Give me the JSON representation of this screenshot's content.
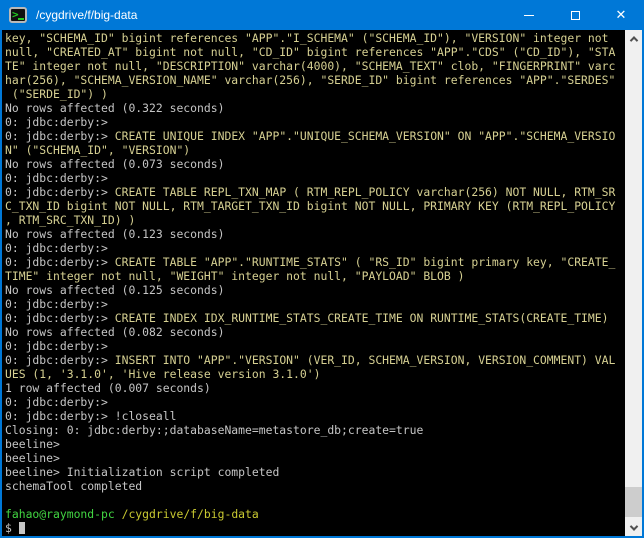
{
  "window": {
    "title": "/cygdrive/f/big-data",
    "app_icon": "mintty-terminal-icon",
    "controls": {
      "minimize": "minimize-icon",
      "maximize": "maximize-icon",
      "close": "close-icon"
    }
  },
  "colors": {
    "titlebar": "#0078d7",
    "terminal_bg": "#000000",
    "text_default": "#c5c5c5",
    "text_command": "#d6d092",
    "text_user_host": "#42d542",
    "text_path": "#c9c931",
    "scrollbar_track": "#f0f0f0",
    "scrollbar_thumb": "#cdcdcd"
  },
  "scrollbar": {
    "up_icon": "chevron-up-icon",
    "down_icon": "chevron-down-icon"
  },
  "terminal": {
    "lines": [
      [
        {
          "c": "cmd",
          "t": "key, \"SCHEMA_ID\" bigint references \"APP\".\"I_SCHEMA\" (\"SCHEMA_ID\"), \"VERSION\" integer not"
        }
      ],
      [
        {
          "c": "cmd",
          "t": "null, \"CREATED_AT\" bigint not null, \"CD_ID\" bigint references \"APP\".\"CDS\" (\"CD_ID\"), \"STA"
        }
      ],
      [
        {
          "c": "cmd",
          "t": "TE\" integer not null, \"DESCRIPTION\" varchar(4000), \"SCHEMA_TEXT\" clob, \"FINGERPRINT\" varc"
        }
      ],
      [
        {
          "c": "cmd",
          "t": "har(256), \"SCHEMA_VERSION_NAME\" varchar(256), \"SERDE_ID\" bigint references \"APP\".\"SERDES\""
        }
      ],
      [
        {
          "c": "cmd",
          "t": " (\"SERDE_ID\") )"
        }
      ],
      [
        {
          "c": "fg",
          "t": "No rows affected (0.322 seconds)"
        }
      ],
      [
        {
          "c": "fg",
          "t": "0: jdbc:derby:>"
        }
      ],
      [
        {
          "c": "fg",
          "t": "0: jdbc:derby:> "
        },
        {
          "c": "cmd",
          "t": "CREATE UNIQUE INDEX \"APP\".\"UNIQUE_SCHEMA_VERSION\" ON \"APP\".\"SCHEMA_VERSIO"
        }
      ],
      [
        {
          "c": "cmd",
          "t": "N\" (\"SCHEMA_ID\", \"VERSION\")"
        }
      ],
      [
        {
          "c": "fg",
          "t": "No rows affected (0.073 seconds)"
        }
      ],
      [
        {
          "c": "fg",
          "t": "0: jdbc:derby:>"
        }
      ],
      [
        {
          "c": "fg",
          "t": "0: jdbc:derby:> "
        },
        {
          "c": "cmd",
          "t": "CREATE TABLE REPL_TXN_MAP ( RTM_REPL_POLICY varchar(256) NOT NULL, RTM_SR"
        }
      ],
      [
        {
          "c": "cmd",
          "t": "C_TXN_ID bigint NOT NULL, RTM_TARGET_TXN_ID bigint NOT NULL, PRIMARY KEY (RTM_REPL_POLICY"
        }
      ],
      [
        {
          "c": "cmd",
          "t": ", RTM_SRC_TXN_ID) )"
        }
      ],
      [
        {
          "c": "fg",
          "t": "No rows affected (0.123 seconds)"
        }
      ],
      [
        {
          "c": "fg",
          "t": "0: jdbc:derby:>"
        }
      ],
      [
        {
          "c": "fg",
          "t": "0: jdbc:derby:> "
        },
        {
          "c": "cmd",
          "t": "CREATE TABLE \"APP\".\"RUNTIME_STATS\" ( \"RS_ID\" bigint primary key, \"CREATE_"
        }
      ],
      [
        {
          "c": "cmd",
          "t": "TIME\" integer not null, \"WEIGHT\" integer not null, \"PAYLOAD\" BLOB )"
        }
      ],
      [
        {
          "c": "fg",
          "t": "No rows affected (0.125 seconds)"
        }
      ],
      [
        {
          "c": "fg",
          "t": "0: jdbc:derby:>"
        }
      ],
      [
        {
          "c": "fg",
          "t": "0: jdbc:derby:> "
        },
        {
          "c": "cmd",
          "t": "CREATE INDEX IDX_RUNTIME_STATS_CREATE_TIME ON RUNTIME_STATS(CREATE_TIME)"
        }
      ],
      [
        {
          "c": "fg",
          "t": "No rows affected (0.082 seconds)"
        }
      ],
      [
        {
          "c": "fg",
          "t": "0: jdbc:derby:>"
        }
      ],
      [
        {
          "c": "fg",
          "t": "0: jdbc:derby:> "
        },
        {
          "c": "cmd",
          "t": "INSERT INTO \"APP\".\"VERSION\" (VER_ID, SCHEMA_VERSION, VERSION_COMMENT) VAL"
        }
      ],
      [
        {
          "c": "cmd",
          "t": "UES (1, '3.1.0', 'Hive release version 3.1.0')"
        }
      ],
      [
        {
          "c": "fg",
          "t": "1 row affected (0.007 seconds)"
        }
      ],
      [
        {
          "c": "fg",
          "t": "0: jdbc:derby:>"
        }
      ],
      [
        {
          "c": "fg",
          "t": "0: jdbc:derby:> !closeall"
        }
      ],
      [
        {
          "c": "fg",
          "t": "Closing: 0: jdbc:derby:;databaseName=metastore_db;create=true"
        }
      ],
      [
        {
          "c": "fg",
          "t": "beeline>"
        }
      ],
      [
        {
          "c": "fg",
          "t": "beeline>"
        }
      ],
      [
        {
          "c": "fg",
          "t": "beeline> Initialization script completed"
        }
      ],
      [
        {
          "c": "fg",
          "t": "schemaTool completed"
        }
      ],
      [],
      [
        {
          "c": "green",
          "t": "fahao@raymond-pc"
        },
        {
          "c": "fg",
          "t": " "
        },
        {
          "c": "yellow",
          "t": "/cygdrive/f/big-data"
        }
      ],
      [
        {
          "c": "fg",
          "t": "$ "
        },
        {
          "c": "cursor",
          "t": ""
        }
      ]
    ]
  }
}
